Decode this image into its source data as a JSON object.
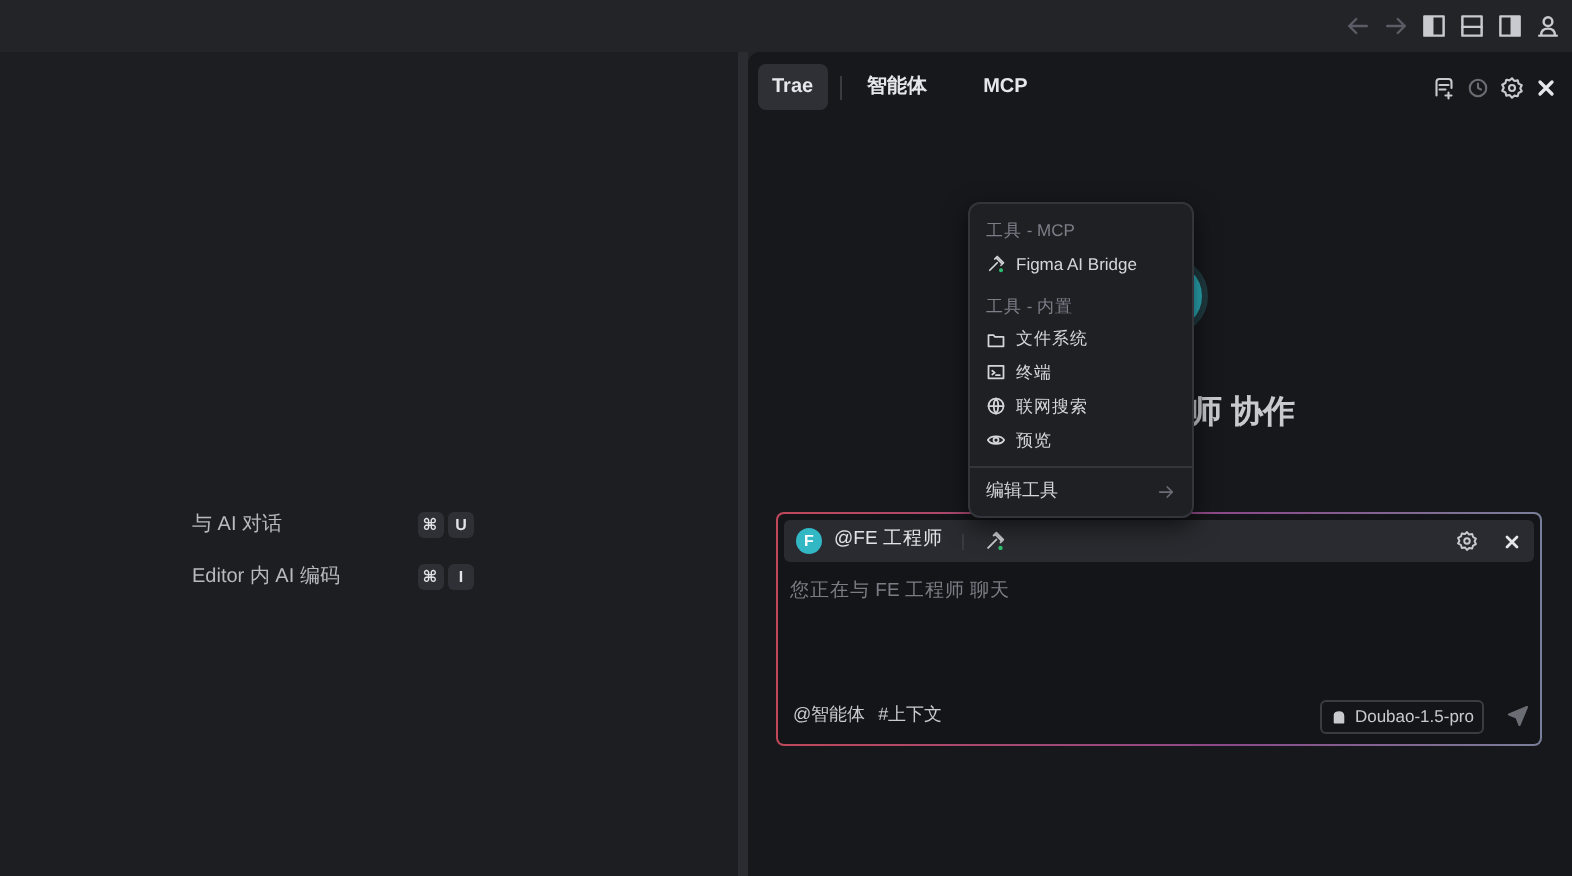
{
  "shortcuts": [
    {
      "label": "与 AI 对话",
      "keys": [
        "⌘",
        "U"
      ]
    },
    {
      "label": "Editor 内 AI 编码",
      "keys": [
        "⌘",
        "I"
      ]
    }
  ],
  "tabs": [
    {
      "label": "Trae",
      "selected": true
    },
    {
      "label": "智能体",
      "selected": false
    },
    {
      "label": "MCP",
      "selected": false
    }
  ],
  "headline": "师 协作",
  "tool_menu": {
    "sections": [
      {
        "title": "工具 - MCP",
        "items": [
          {
            "label": "Figma AI Bridge",
            "kind": "mcp"
          }
        ]
      },
      {
        "title": "工具 - 内置",
        "items": [
          {
            "label": "文件系统",
            "kind": "folder"
          },
          {
            "label": "终端",
            "kind": "terminal"
          },
          {
            "label": "联网搜索",
            "kind": "globe"
          },
          {
            "label": "预览",
            "kind": "eye"
          }
        ]
      }
    ],
    "footer": "编辑工具"
  },
  "composer": {
    "avatar_letter": "F",
    "agent": "@FE 工程师",
    "placeholder": "您正在与 FE 工程师 聊天",
    "actions": [
      "@智能体",
      "#上下文"
    ],
    "model": "Doubao-1.5-pro"
  }
}
